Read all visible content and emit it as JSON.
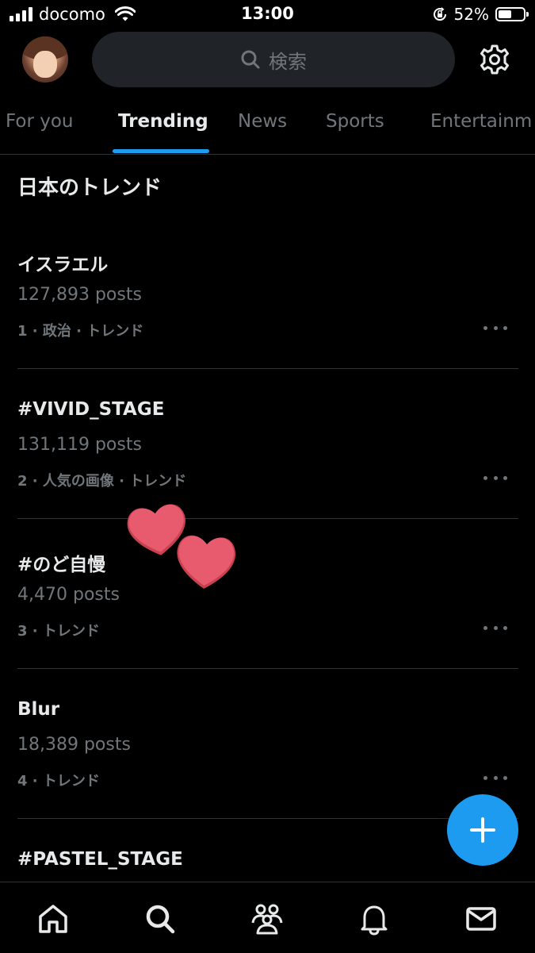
{
  "status_bar": {
    "carrier": "docomo",
    "time": "13:00",
    "battery_percent": "52%",
    "battery_level": 0.52,
    "icons": [
      "signal-icon",
      "wifi-icon",
      "orientation-lock-icon",
      "battery-icon"
    ]
  },
  "header": {
    "avatar": "avatar",
    "search_placeholder": "検索",
    "search_icon": "search-icon",
    "settings_icon": "gear-icon"
  },
  "tabs": [
    {
      "label": "For you",
      "active": false
    },
    {
      "label": "Trending",
      "active": true
    },
    {
      "label": "News",
      "active": false
    },
    {
      "label": "Sports",
      "active": false
    },
    {
      "label": "Entertainm",
      "active": false
    }
  ],
  "section_title": "日本のトレンド",
  "trends": [
    {
      "name": "イスラエル",
      "posts": "127,893 posts",
      "meta": "1 · 政治 · トレンド"
    },
    {
      "name": "#VIVID_STAGE",
      "posts": "131,119 posts",
      "meta": "2 · 人気の画像 · トレンド"
    },
    {
      "name": "#のど自慢",
      "posts": "4,470 posts",
      "meta": "3 · トレンド"
    },
    {
      "name": "Blur",
      "posts": "18,389 posts",
      "meta": "4 · トレンド"
    },
    {
      "name": "#PASTEL_STAGE",
      "posts": "",
      "meta": ""
    }
  ],
  "fab": {
    "icon": "plus-icon"
  },
  "bottom_nav": [
    {
      "icon": "home-icon"
    },
    {
      "icon": "search-icon"
    },
    {
      "icon": "communities-icon"
    },
    {
      "icon": "bell-icon"
    },
    {
      "icon": "mail-icon"
    }
  ],
  "colors": {
    "background": "#000000",
    "accent": "#1d9bf0",
    "primary_text": "#e7e9ea",
    "secondary_text": "#71767b",
    "divider": "#2f3336",
    "search_bg": "#202327",
    "heart": "#e85b6e"
  }
}
